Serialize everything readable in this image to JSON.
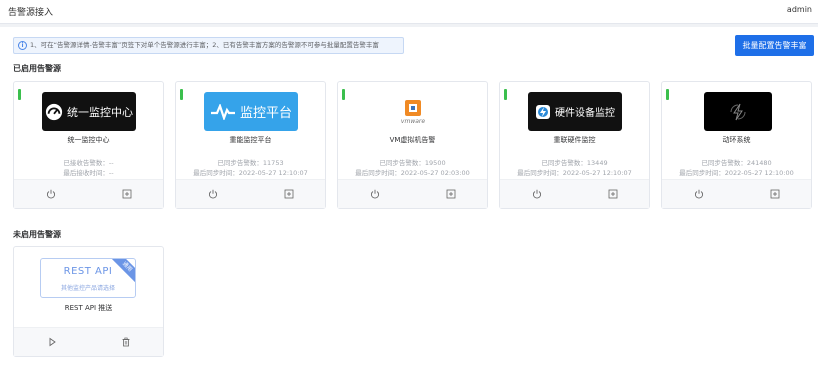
{
  "header": {
    "title": "告警源接入",
    "user": "admin"
  },
  "notice": {
    "icon": "info-icon",
    "text": "1、可在“告警源详情-告警丰富”页签下对单个告警源进行丰富；2、已有告警丰富方案的告警源不可参与批量配置告警丰富"
  },
  "batch_button": {
    "label": "批量配置告警丰富"
  },
  "enabled_section": {
    "title": "已启用告警源"
  },
  "disabled_section": {
    "title": "未启用告警源"
  },
  "enabled_sources": [
    {
      "name": "统一监控中心",
      "logo_text": "统一监控中心",
      "logo_icon": "speedometer-icon",
      "stat_count_label": "已接收告警数：--",
      "stat_time_label": "最后接收时间：--"
    },
    {
      "name": "重能监控平台",
      "logo_text": "监控平台",
      "logo_icon": "pulse-icon",
      "stat_count_label": "已同步告警数：11753",
      "stat_time_label": "最后同步时间：2022-05-27 12:10:07"
    },
    {
      "name": "VM虚拟机告警",
      "logo_text": "vmware",
      "logo_icon": "vmware-icon",
      "stat_count_label": "已同步告警数：19500",
      "stat_time_label": "最后同步时间：2022-05-27 02:03:00"
    },
    {
      "name": "重联硬件监控",
      "logo_text": "硬件设备监控",
      "logo_icon": "lightning-icon",
      "stat_count_label": "已同步告警数：13449",
      "stat_time_label": "最后同步时间：2022-05-27 12:10:07"
    },
    {
      "name": "动环系统",
      "logo_text": "",
      "logo_icon": "bolt-logo-icon",
      "stat_count_label": "已同步告警数：241480",
      "stat_time_label": "最后同步时间：2022-05-27 12:10:00"
    }
  ],
  "disabled_sources": [
    {
      "name": "REST API 推送",
      "logo_title": "REST API",
      "logo_subtitle": "其他监控产品请选择",
      "corner_badge": "通用",
      "actions": [
        "play-icon",
        "trash-icon"
      ]
    }
  ],
  "colors": {
    "primary": "#1e6fe8",
    "active": "#3bbf4d",
    "rest": "#6b95e6"
  }
}
